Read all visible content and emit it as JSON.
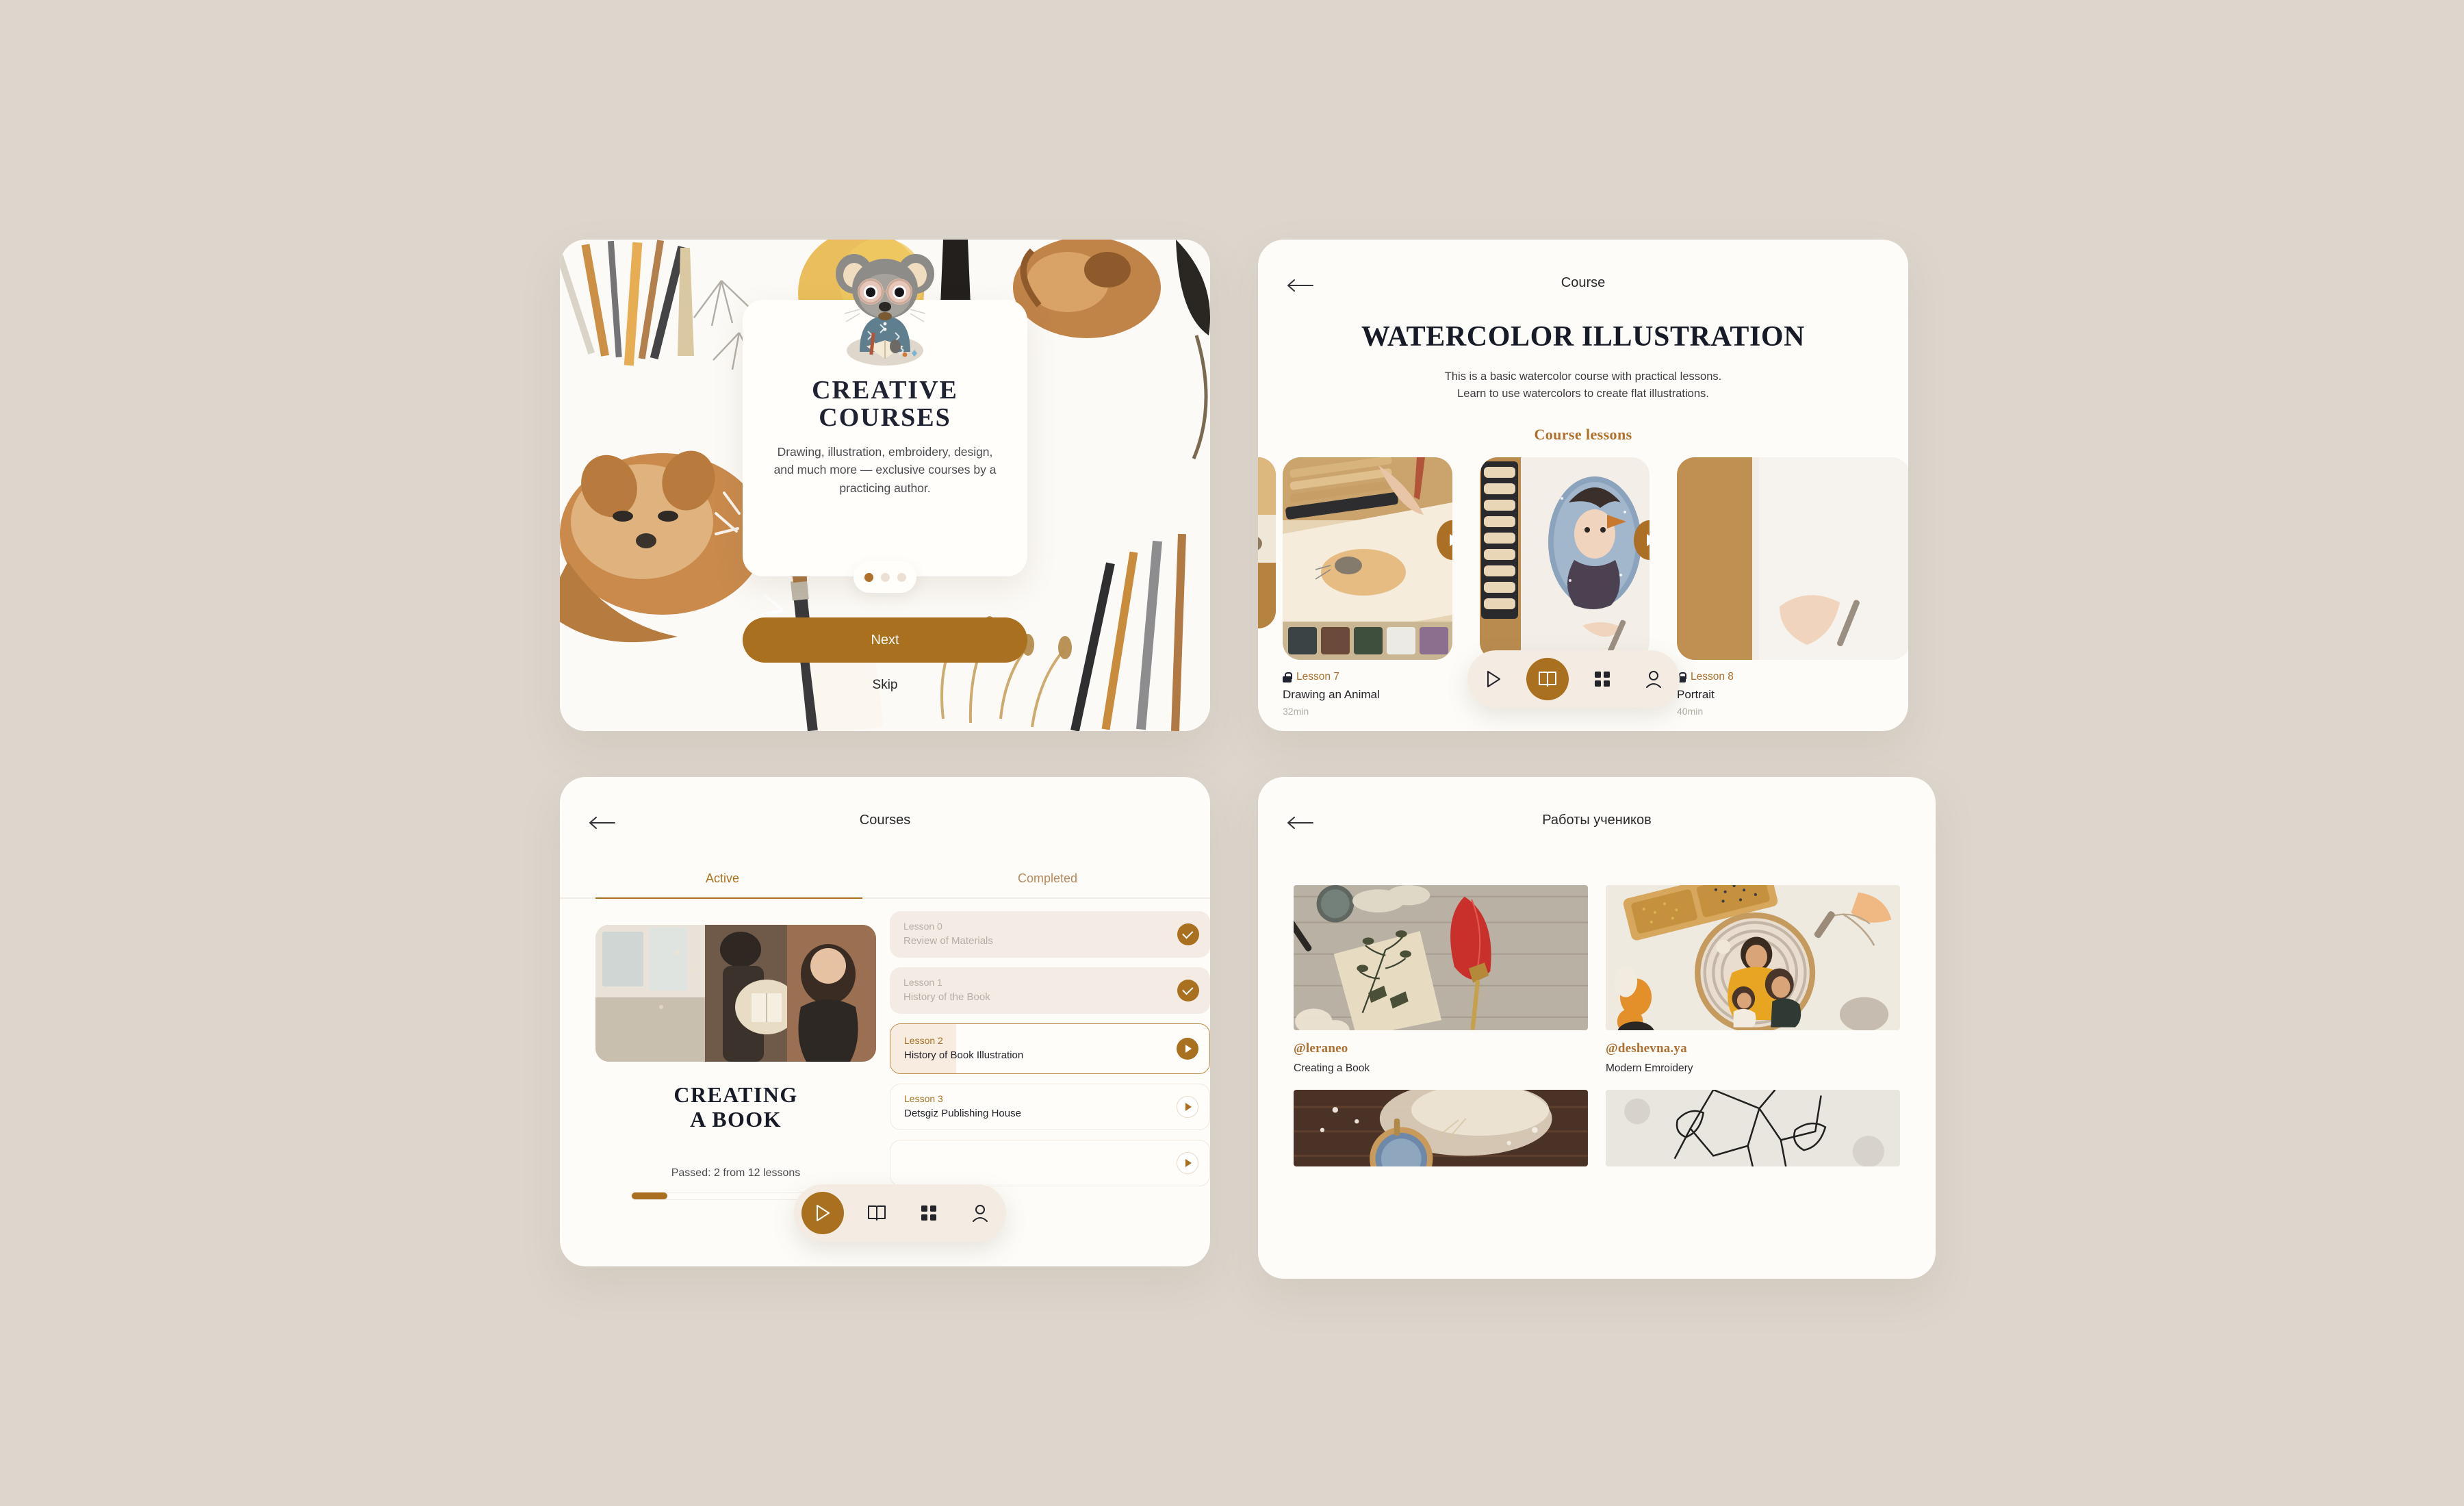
{
  "theme": {
    "background": "#ddd6cd",
    "panel": "#fdfcf8",
    "accent": "#a9701f",
    "accent_text": "#ac7134",
    "dark": "#1e2231"
  },
  "onboarding": {
    "title": "CREATIVE\nCOURSES",
    "title_line1": "CREATIVE",
    "title_line2": "COURSES",
    "description": "Drawing, illustration, embroidery, design, and much more — exclusive courses by a practicing author.",
    "dots": {
      "total": 3,
      "active_index": 0
    },
    "next_label": "Next",
    "skip_label": "Skip",
    "mascot": "mouse-illustrator-mascot"
  },
  "course": {
    "header_title": "Course",
    "back_icon": "back-arrow-icon",
    "title": "WATERCOLOR ILLUSTRATION",
    "description": "This is a basic watercolor course with practical lessons. Learn to use watercolors to create flat illustrations.",
    "lessons_label": "Course lessons",
    "lessons": [
      {
        "number": "Lesson 7",
        "name": "Drawing an Animal",
        "duration": "32min",
        "locked": true
      },
      {
        "number": "Lesson 8",
        "name": "Portrait",
        "duration": "40min",
        "locked": true
      }
    ],
    "nav": [
      {
        "icon": "play-icon",
        "active": false
      },
      {
        "icon": "book-icon",
        "active": true
      },
      {
        "icon": "grid-icon",
        "active": false
      },
      {
        "icon": "person-icon",
        "active": false
      }
    ]
  },
  "courses": {
    "header_title": "Courses",
    "back_icon": "back-arrow-icon",
    "tabs": [
      {
        "label": "Active",
        "active": true
      },
      {
        "label": "Completed",
        "active": false
      }
    ],
    "hero_title_line1": "CREATING",
    "hero_title_line2": "A BOOK",
    "progress_text": "Passed: 2 from 12 lessons",
    "progress_percent": 17,
    "lessons": [
      {
        "number": "Lesson 0",
        "name": "Review of Materials",
        "state": "done"
      },
      {
        "number": "Lesson 1",
        "name": "History of the Book",
        "state": "done"
      },
      {
        "number": "Lesson 2",
        "name": "History of Book Illustration",
        "state": "current"
      },
      {
        "number": "Lesson 3",
        "name": "Detsgiz Publishing House",
        "state": "upcoming"
      },
      {
        "number": "",
        "name": "",
        "state": "upcoming"
      }
    ],
    "nav": [
      {
        "icon": "play-icon",
        "active": true
      },
      {
        "icon": "book-icon",
        "active": false
      },
      {
        "icon": "grid-icon",
        "active": false
      },
      {
        "icon": "person-icon",
        "active": false
      }
    ]
  },
  "gallery": {
    "header_title": "Работы учеников",
    "back_icon": "back-arrow-icon",
    "items": [
      {
        "user": "@leraneo",
        "caption": "Creating a Book",
        "image": "botanical-card-with-red-quill"
      },
      {
        "user": "@deshevna.ya",
        "caption": "Modern Emroidery",
        "image": "embroidery-hoop-family-portrait"
      },
      {
        "user": "",
        "caption": "",
        "image": "embroidery-hoop-on-dark-wood"
      },
      {
        "user": "",
        "caption": "",
        "image": "line-embroidery-on-white-fabric"
      }
    ]
  }
}
